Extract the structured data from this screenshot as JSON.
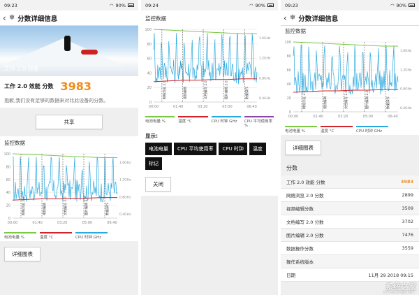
{
  "status": {
    "p1_time": "09:23",
    "p2_time": "09:24",
    "p3_time": "09:23",
    "battery": "90%"
  },
  "header": {
    "title": "分数详细信息"
  },
  "panel1": {
    "hero_label": "工作 2.0 效能",
    "score_label": "工作 2.0 效能 分数",
    "score_value": "3983",
    "note": "抱歉,我们没有足够的数据来对比此设备的分数。",
    "share_button": "共享",
    "monitor_title": "监控数据",
    "detail_button": "详细图表"
  },
  "panel2": {
    "monitor_title": "监控数据",
    "display_label": "显示:",
    "chips": [
      "电池电量",
      "CPU 平均使用率",
      "CPU 时钟",
      "温度",
      "标记"
    ],
    "close_button": "关闭"
  },
  "panel3": {
    "monitor_title": "监控数据",
    "detail_button": "详细图表",
    "scores_title": "分数",
    "scores": [
      {
        "label": "工作 2.0 效能 分数",
        "value": "3983"
      },
      {
        "label": "网络浏览 2.0 分数",
        "value": "2899"
      },
      {
        "label": "视频编辑分数",
        "value": "3509"
      },
      {
        "label": "文档编写 2.0 分数",
        "value": "3702"
      },
      {
        "label": "图片编辑 2.0 分数",
        "value": "7476"
      },
      {
        "label": "数据操作分数",
        "value": "3559"
      },
      {
        "label": "操作系统版本",
        "value": ""
      },
      {
        "label": "日期",
        "value": "11月 29 2018 09:15"
      }
    ]
  },
  "watermark": {
    "main": "系统之家",
    "sub": "XITONGZHIJIA.NET"
  },
  "legend": {
    "battery": "电池电量 %",
    "temp": "温度 °C",
    "cpu_clock": "CPU 时钟 GHz",
    "cpu_usage": "CPU 平均使用率 %"
  },
  "chart_data": {
    "type": "line",
    "x_ticks": [
      "00:00",
      "01:40",
      "03:20",
      "05:00",
      "06:40"
    ],
    "y_left_ticks": [
      "100",
      "80",
      "60",
      "40",
      "20",
      "0"
    ],
    "y_right_ticks": [
      "1.6GHz",
      "1.2GHz",
      "0.8GHz",
      "0.4GHz"
    ],
    "markers": [
      "网络浏览 2.0",
      "视频编辑",
      "文档编写 2.0",
      "图片编辑 2.0",
      "数据操作"
    ],
    "colors": {
      "battery": "#7ac943",
      "temp": "#d2232a",
      "cpu_clock": "#29a9e0",
      "cpu_usage": "#8e44ad"
    },
    "series": [
      {
        "name": "电池电量 %",
        "values": [
          100,
          99,
          98,
          97,
          96,
          95,
          94,
          94
        ]
      },
      {
        "name": "温度 °C",
        "values": [
          28,
          29,
          30,
          30,
          31,
          31,
          32,
          32
        ]
      }
    ]
  }
}
